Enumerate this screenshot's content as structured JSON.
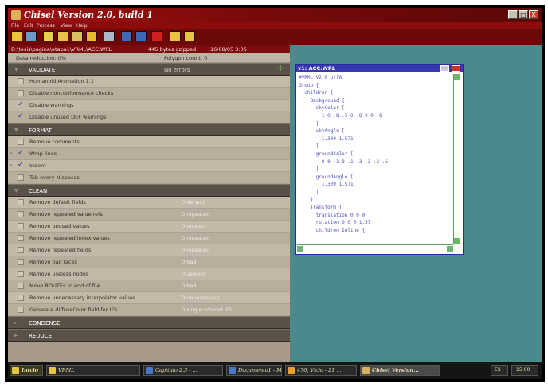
{
  "window": {
    "title": "Chisel Version 2.0, build 1",
    "minimize": "_",
    "maximize": "□",
    "close": "X"
  },
  "menu": [
    "File",
    "Edit",
    "Process",
    "View",
    "Help"
  ],
  "path": {
    "file": "D:\\tesis\\pagina\\etapa1\\VRML\\ACC.WRL",
    "size": "445 bytes gzipped",
    "date": "16/08/05 3:05"
  },
  "stats": {
    "reduction": "Data reduction: 0%",
    "polygons": "Polygon count: 0"
  },
  "validate": {
    "label": "VALIDATE",
    "status": "No errors"
  },
  "validate_options": [
    {
      "label": "Humanoid Animation 1.1",
      "checked": false
    },
    {
      "label": "Disable nonconformance checks",
      "checked": false
    },
    {
      "label": "Disable warnings",
      "checked": true
    },
    {
      "label": "Disable unused DEF warnings",
      "checked": true
    }
  ],
  "format": {
    "label": "FORMAT"
  },
  "format_options": [
    {
      "label": "Remove comments",
      "checked": false
    },
    {
      "label": "Wrap lines",
      "checked": true
    },
    {
      "label": "Indent",
      "checked": true
    },
    {
      "label": "Tab every N spaces",
      "checked": false
    }
  ],
  "clean": {
    "label": "CLEAN"
  },
  "clean_options": [
    {
      "label": "Remove default fields",
      "value": "0 default"
    },
    {
      "label": "Remove repeated value refs",
      "value": "0 repeated"
    },
    {
      "label": "Remove unused values",
      "value": "0 unused"
    },
    {
      "label": "Remove repeated index values",
      "value": "0 repeated"
    },
    {
      "label": "Remove repeated fields",
      "value": "0 repeated"
    },
    {
      "label": "Remove bad faces",
      "value": "0 bad"
    },
    {
      "label": "Remove useless nodes",
      "value": "0 useless"
    },
    {
      "label": "Move ROUTEs to end of file",
      "value": "0 bad"
    },
    {
      "label": "Remove unnecessary interpolator values",
      "value": "0 unnecessary"
    },
    {
      "label": "Generate diffuseColor field for IFS",
      "value": "0 single colored IFS"
    }
  ],
  "condense": {
    "label": "CONDENSE"
  },
  "reduce": {
    "label": "REDUCE"
  },
  "vrml_window": {
    "title": "v1: ACC.WRL",
    "code": "#VRML V2.0 utf8\nGroup {\n  children [\n    Background {\n      skyColor [\n        1 0 .8 .5 0 .8 0 0 .8\n      ]\n      skyAngle [\n        1.309 1.571\n      ]\n      groundColor [\n        0 0 .1 0 .1 .3 .3 .3 .6\n      ]\n      groundAngle [\n        1.309 1.571\n      ]\n    }\n    Transform {\n      translation 0 0 0\n      rotation 0 0 0 1.57\n      children Inline {"
  },
  "taskbar": {
    "start": "Inicio",
    "tasks": [
      "VRML",
      "Capitulo 2.3 - ...",
      "Documento1 - M...",
      "476, Vicio - 21 ...",
      "Chisel Version..."
    ],
    "tray": [
      "ES",
      "15:00"
    ]
  }
}
